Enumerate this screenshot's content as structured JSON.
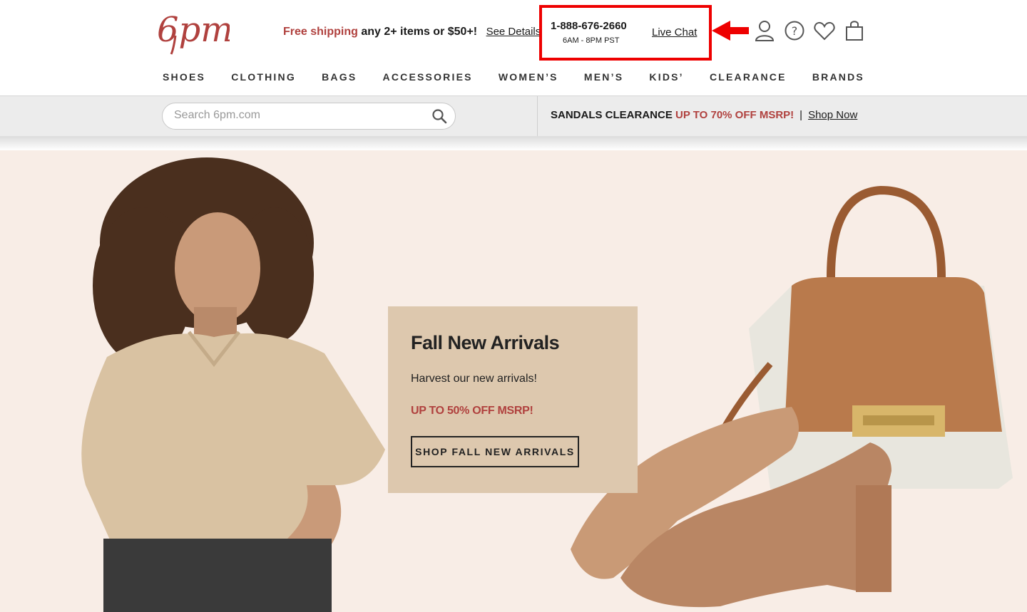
{
  "header": {
    "logo_text": "6pm",
    "promo": {
      "free_shipping": "Free shipping",
      "rest": " any 2+ items or $50+!",
      "see_details": "See Details"
    },
    "contact": {
      "phone": "1-888-676-2660",
      "hours": "6AM - 8PM PST",
      "live_chat": "Live Chat"
    },
    "icons": [
      "account-icon",
      "help-icon",
      "heart-icon",
      "cart-icon"
    ]
  },
  "nav": [
    "SHOES",
    "CLOTHING",
    "BAGS",
    "ACCESSORIES",
    "WOMEN’S",
    "MEN’S",
    "KIDS’",
    "CLEARANCE",
    "BRANDS"
  ],
  "search": {
    "placeholder": "Search 6pm.com"
  },
  "sale_banner": {
    "lead": "SANDALS CLEARANCE",
    "offer": "UP TO 70% OFF MSRP!",
    "separator": "|",
    "shop_now": "Shop Now"
  },
  "hero": {
    "title": "Fall New Arrivals",
    "subtitle": "Harvest our new arrivals!",
    "offer": "UP TO 50% OFF MSRP!",
    "cta": "SHOP FALL NEW ARRIVALS"
  },
  "colors": {
    "brand_red": "#b0413e",
    "highlight_red": "#ee0000",
    "hero_bg": "#f8ede6",
    "card_bg": "#ddc8ae"
  }
}
